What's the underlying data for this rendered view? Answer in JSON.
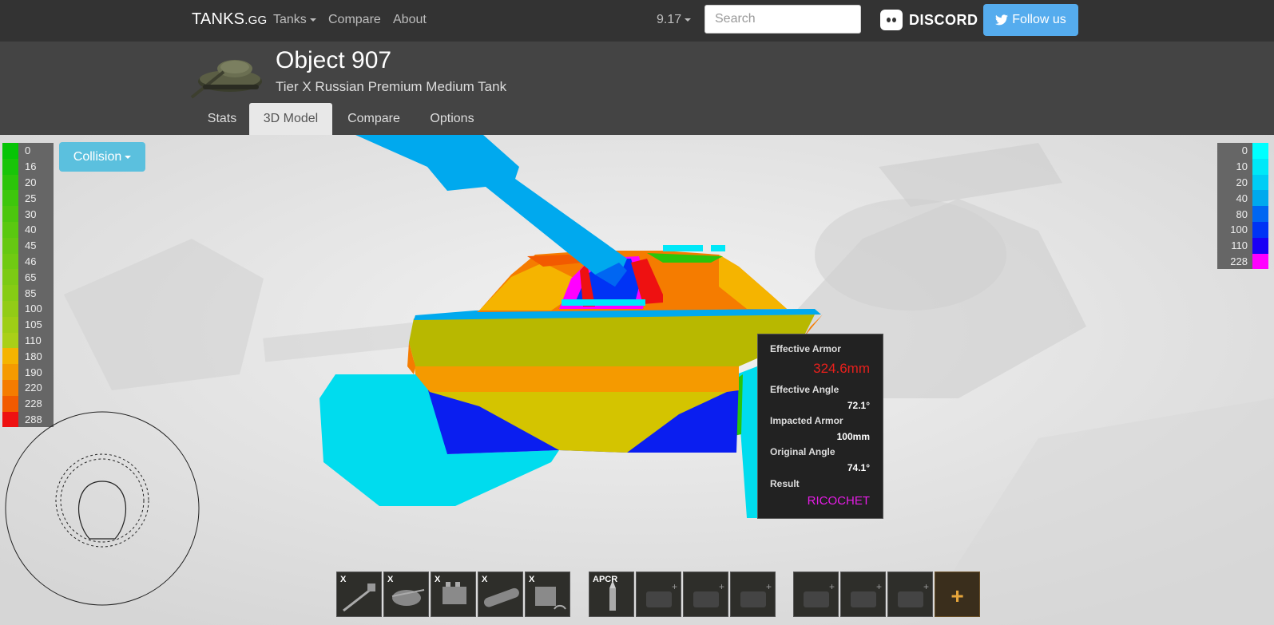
{
  "nav": {
    "brand_main": "TANKS",
    "brand_suffix": ".GG",
    "tanks_label": "Tanks",
    "compare_label": "Compare",
    "about_label": "About",
    "version_label": "9.17",
    "search_placeholder": "Search",
    "discord_label": "DISCORD",
    "follow_label": "Follow us"
  },
  "header": {
    "tank_name": "Object 907",
    "tank_description": "Tier X Russian Premium Medium Tank",
    "tabs": [
      {
        "label": "Stats",
        "active": false
      },
      {
        "label": "3D Model",
        "active": true
      },
      {
        "label": "Compare",
        "active": false
      },
      {
        "label": "Options",
        "active": false
      }
    ]
  },
  "viewer": {
    "mode_label": "Collision",
    "left_legend": [
      {
        "value": "0",
        "color": "#06c406"
      },
      {
        "value": "16",
        "color": "#18c408"
      },
      {
        "value": "20",
        "color": "#2bc40a"
      },
      {
        "value": "25",
        "color": "#3ec60c"
      },
      {
        "value": "30",
        "color": "#4cc60e"
      },
      {
        "value": "40",
        "color": "#5ac810"
      },
      {
        "value": "45",
        "color": "#66c812"
      },
      {
        "value": "46",
        "color": "#70ca12"
      },
      {
        "value": "65",
        "color": "#7cca14"
      },
      {
        "value": "85",
        "color": "#86cc14"
      },
      {
        "value": "100",
        "color": "#92cc16"
      },
      {
        "value": "105",
        "color": "#9ece16"
      },
      {
        "value": "110",
        "color": "#aad018"
      },
      {
        "value": "180",
        "color": "#f5b400"
      },
      {
        "value": "190",
        "color": "#f59a00"
      },
      {
        "value": "220",
        "color": "#f57c00"
      },
      {
        "value": "228",
        "color": "#f25a00"
      },
      {
        "value": "288",
        "color": "#ee1111"
      }
    ],
    "right_legend": [
      {
        "value": "0",
        "color": "#00ffff"
      },
      {
        "value": "10",
        "color": "#00e8f8"
      },
      {
        "value": "20",
        "color": "#00cdf5"
      },
      {
        "value": "40",
        "color": "#00a9ee"
      },
      {
        "value": "80",
        "color": "#0066f2"
      },
      {
        "value": "100",
        "color": "#0033f5"
      },
      {
        "value": "110",
        "color": "#1a00f5"
      },
      {
        "value": "228",
        "color": "#ff00ff"
      }
    ],
    "tooltip": {
      "effective_armor_label": "Effective Armor",
      "effective_armor_value": "324.6mm",
      "effective_angle_label": "Effective Angle",
      "effective_angle_value": "72.1°",
      "impacted_armor_label": "Impacted Armor",
      "impacted_armor_value": "100mm",
      "original_angle_label": "Original Angle",
      "original_angle_value": "74.1°",
      "result_label": "Result",
      "result_value": "RICOCHET",
      "armor_color": "#e8201c",
      "result_color": "#e81ce8"
    }
  },
  "equipment": {
    "modules": [
      {
        "tier": "X",
        "name": "gun-icon"
      },
      {
        "tier": "X",
        "name": "turret-icon"
      },
      {
        "tier": "X",
        "name": "engine-icon"
      },
      {
        "tier": "X",
        "name": "tracks-icon"
      },
      {
        "tier": "X",
        "name": "radio-icon"
      }
    ],
    "ammo": [
      {
        "label": "APCR",
        "name": "ammo-apcr-icon"
      },
      {
        "label": "",
        "name": "empty-slot-icon"
      },
      {
        "label": "",
        "name": "empty-slot-icon"
      },
      {
        "label": "",
        "name": "empty-slot-icon"
      }
    ],
    "consumables": [
      {
        "label": "",
        "name": "empty-slot-icon"
      },
      {
        "label": "",
        "name": "empty-slot-icon"
      },
      {
        "label": "",
        "name": "empty-slot-icon"
      }
    ],
    "add_label": "+"
  }
}
